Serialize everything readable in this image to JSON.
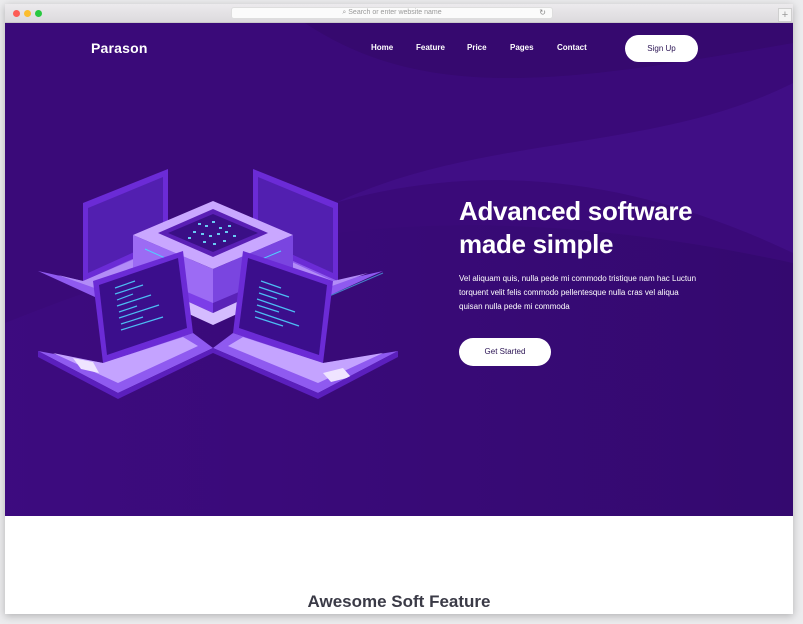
{
  "browser": {
    "url_placeholder": "Search or enter website name",
    "newtab_label": "+"
  },
  "site": {
    "logo": "Parason",
    "nav": [
      "Home",
      "Feature",
      "Price",
      "Pages",
      "Contact"
    ],
    "signup_label": "Sign Up"
  },
  "hero": {
    "headline": "Advanced software made simple",
    "description": "Vel aliquam quis, nulla pede mi commodo tristique nam hac Luctun torquent velit felis commodo pellentesque nulla cras vel aliqua quisan nulla pede mi commoda",
    "cta_label": "Get Started"
  },
  "features": {
    "title": "Awesome Soft Feature"
  },
  "colors": {
    "hero_bg": "#3a0a79",
    "accent": "#7b3fe4",
    "white": "#ffffff"
  }
}
